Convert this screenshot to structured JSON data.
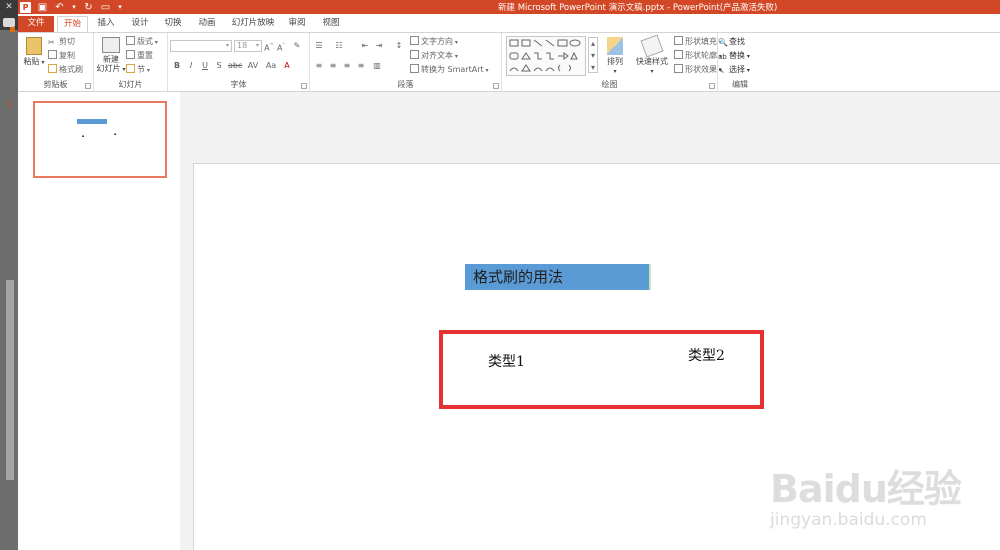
{
  "window": {
    "title": "新建 Microsoft PowerPoint 演示文稿.pptx - PowerPoint(产品激活失败)"
  },
  "tabs": [
    {
      "label": "文件"
    },
    {
      "label": "开始"
    },
    {
      "label": "插入"
    },
    {
      "label": "设计"
    },
    {
      "label": "切换"
    },
    {
      "label": "动画"
    },
    {
      "label": "幻灯片放映"
    },
    {
      "label": "审阅"
    },
    {
      "label": "视图"
    }
  ],
  "ribbon": {
    "clipboard": {
      "label": "剪贴板",
      "paste": "粘贴",
      "cut": "剪切",
      "copy": "复制",
      "format_painter": "格式刷"
    },
    "slides": {
      "label": "幻灯片",
      "new_slide_line1": "新建",
      "new_slide_line2": "幻灯片",
      "layout": "版式",
      "reset": "重置",
      "section": "节"
    },
    "font": {
      "label": "字体",
      "font_size": "18"
    },
    "paragraph": {
      "label": "段落",
      "text_direction": "文字方向",
      "align_text": "对齐文本",
      "convert_smartart": "转换为 SmartArt"
    },
    "drawing": {
      "label": "绘图",
      "arrange": "排列",
      "quick_styles": "快速样式",
      "shape_fill": "形状填充",
      "shape_outline": "形状轮廓",
      "shape_effects": "形状效果"
    },
    "editing": {
      "label": "编辑",
      "find": "查找",
      "replace": "替换",
      "select": "选择"
    }
  },
  "thumbnails": {
    "number": "1"
  },
  "slide": {
    "title": "格式刷的用法",
    "text1": "类型1",
    "text2": "类型2"
  },
  "watermark": {
    "brand": "Baidu经验",
    "url": "jingyan.baidu.com"
  },
  "colors": {
    "accent": "#d24726",
    "title_fill": "#5b9bd5",
    "frame": "#e53333"
  }
}
